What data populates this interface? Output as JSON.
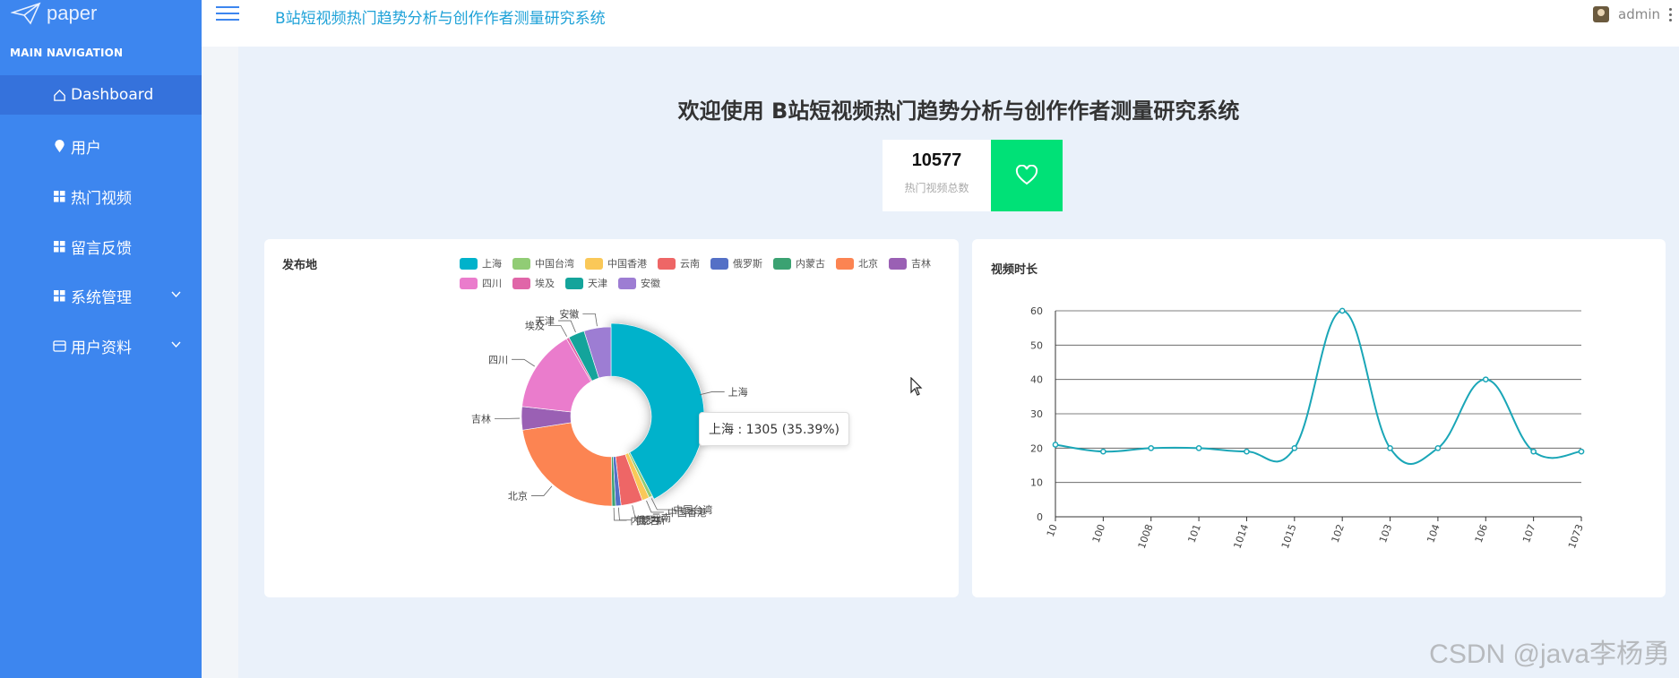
{
  "app": {
    "logo_text": "paper",
    "title": "B站短视频热门趋势分析与创作作者测量研究系统"
  },
  "nav": {
    "section_title": "MAIN NAVIGATION",
    "items": [
      {
        "label": "Dashboard",
        "icon": "home-icon",
        "active": true
      },
      {
        "label": "用户",
        "icon": "pin-icon"
      },
      {
        "label": "热门视频",
        "icon": "grid-icon"
      },
      {
        "label": "留言反馈",
        "icon": "grid-icon"
      },
      {
        "label": "系统管理",
        "icon": "grid-icon",
        "expandable": true
      },
      {
        "label": "用户资料",
        "icon": "card-icon",
        "expandable": true
      }
    ]
  },
  "header": {
    "user_name": "admin"
  },
  "main": {
    "welcome": "欢迎使用 B站短视频热门趋势分析与创作作者测量研究系统",
    "stat": {
      "value": "10577",
      "label": "热门视频总数"
    }
  },
  "pie_card": {
    "title": "发布地",
    "tooltip": "上海 : 1305 (35.39%)"
  },
  "line_card": {
    "title": "视频时长"
  },
  "watermark": "CSDN @java李杨勇",
  "chart_data": [
    {
      "type": "pie",
      "title": "发布地",
      "donut": true,
      "labels": [
        "上海",
        "中国台湾",
        "中国香港",
        "云南",
        "俄罗斯",
        "内蒙古",
        "北京",
        "吉林",
        "四川",
        "埃及",
        "天津",
        "安徽"
      ],
      "values": [
        1305,
        20,
        40,
        120,
        30,
        20,
        700,
        130,
        460,
        15,
        90,
        150
      ],
      "colors": [
        "#00b2cb",
        "#91cc75",
        "#fac858",
        "#ee6666",
        "#5470c6",
        "#3ba272",
        "#fc8452",
        "#9a60b4",
        "#ea7ccc",
        "#e066a8",
        "#14a49b",
        "#9d7dd3"
      ],
      "legend_position": "top-right",
      "highlighted": "上海"
    },
    {
      "type": "line",
      "title": "视频时长",
      "x": [
        "10",
        "100",
        "1008",
        "101",
        "1014",
        "1015",
        "102",
        "103",
        "104",
        "106",
        "107",
        "1073"
      ],
      "y": [
        21,
        19,
        20,
        20,
        19,
        20,
        60,
        20,
        20,
        40,
        19,
        19
      ],
      "ylim": [
        0,
        60
      ],
      "yticks": [
        0,
        10,
        20,
        30,
        40,
        50,
        60
      ],
      "color": "#1aa6b7",
      "smooth": true,
      "grid": true
    }
  ]
}
